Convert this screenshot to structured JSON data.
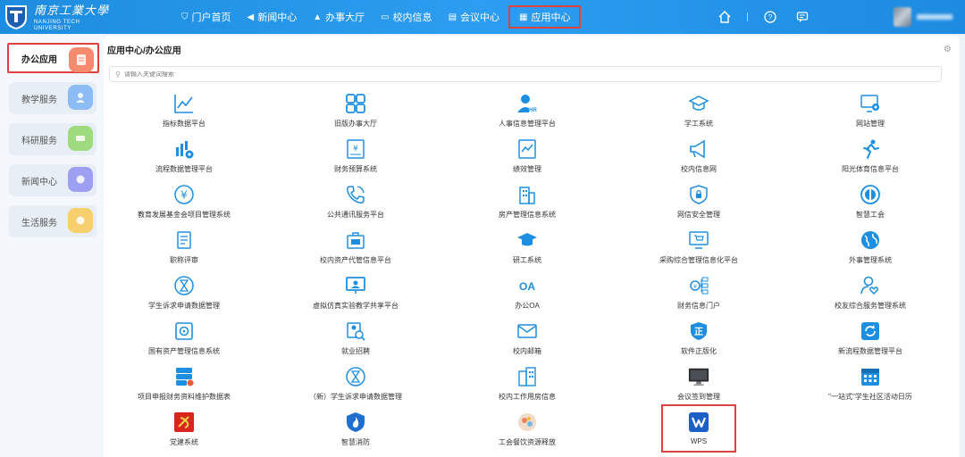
{
  "header": {
    "logo_cn": "南京工業大學",
    "logo_en_1": "NANJING TECH",
    "logo_en_2": "UNIVERSITY",
    "nav": [
      {
        "label": "门户首页",
        "icon": "shield-icon"
      },
      {
        "label": "新闻中心",
        "icon": "speaker-icon"
      },
      {
        "label": "办事大厅",
        "icon": "building-icon"
      },
      {
        "label": "校内信息",
        "icon": "monitor-icon"
      },
      {
        "label": "会议中心",
        "icon": "meeting-icon"
      },
      {
        "label": "应用中心",
        "icon": "grid-icon",
        "active": true
      }
    ],
    "right_icons": [
      "home-icon",
      "help-icon",
      "feedback-icon"
    ]
  },
  "sidebar": {
    "items": [
      {
        "label": "办公应用",
        "color": "#f27a5f",
        "active": true
      },
      {
        "label": "教学服务",
        "color": "#73aef0"
      },
      {
        "label": "科研服务",
        "color": "#8fd56c"
      },
      {
        "label": "新闻中心",
        "color": "#8c8ff0"
      },
      {
        "label": "生活服务",
        "color": "#f5c65a"
      }
    ]
  },
  "main": {
    "breadcrumb": "应用中心/办公应用",
    "search_placeholder": "请输入关键词搜索",
    "accent_color": "#1e90e0",
    "apps": [
      {
        "label": "指标数据平台",
        "icon": "chart-line-icon"
      },
      {
        "label": "旧版办事大厅",
        "icon": "grid-icon"
      },
      {
        "label": "人事信息管理平台",
        "icon": "hr-icon"
      },
      {
        "label": "学工系统",
        "icon": "graduation-icon"
      },
      {
        "label": "网站管理",
        "icon": "monitor-gear-icon"
      },
      {
        "label": "流程数据管理平台",
        "icon": "chart-gear-icon"
      },
      {
        "label": "财务预算系统",
        "icon": "yen-doc-icon"
      },
      {
        "label": "绩效管理",
        "icon": "chart-doc-icon"
      },
      {
        "label": "校内信息网",
        "icon": "megaphone-icon"
      },
      {
        "label": "阳光体育信息平台",
        "icon": "runner-icon"
      },
      {
        "label": "教育发展基金会项目管理系统",
        "icon": "yen-circle-icon"
      },
      {
        "label": "公共通讯服务平台",
        "icon": "phone-icon"
      },
      {
        "label": "房产管理信息系统",
        "icon": "building-icon"
      },
      {
        "label": "网信安全管理",
        "icon": "shield-lock-icon"
      },
      {
        "label": "智慧工会",
        "icon": "union-icon"
      },
      {
        "label": "职称评审",
        "icon": "doc-list-icon"
      },
      {
        "label": "校内资产代管信息平台",
        "icon": "briefcase-icon"
      },
      {
        "label": "研工系统",
        "icon": "graduation-cap-icon"
      },
      {
        "label": "采购综合管理信息化平台",
        "icon": "monitor-cart-icon"
      },
      {
        "label": "外事管理系统",
        "icon": "globe-icon"
      },
      {
        "label": "学生诉求申请数据管理",
        "icon": "hourglass-icon"
      },
      {
        "label": "虚拟仿真实验教学共享平台",
        "icon": "presentation-icon"
      },
      {
        "label": "办公OA",
        "icon": "oa-icon"
      },
      {
        "label": "财务信息门户",
        "icon": "money-network-icon"
      },
      {
        "label": "校友综合服务管理系统",
        "icon": "user-heart-icon"
      },
      {
        "label": "国有资产管理信息系统",
        "icon": "safe-icon"
      },
      {
        "label": "就业招聘",
        "icon": "job-search-icon"
      },
      {
        "label": "校内邮箱",
        "icon": "mail-icon"
      },
      {
        "label": "软件正版化",
        "icon": "zheng-badge-icon"
      },
      {
        "label": "新流程数据管理平台",
        "icon": "refresh-doc-icon"
      },
      {
        "label": "项目申报财务资料维护数据表",
        "icon": "db-edit-icon"
      },
      {
        "label": "（新）学生诉求申请数据管理",
        "icon": "hourglass-icon"
      },
      {
        "label": "校内工作用房信息",
        "icon": "office-building-icon"
      },
      {
        "label": "会议签到管理",
        "icon": "monitor-icon"
      },
      {
        "label": "\"一站式\"学生社区活动日历",
        "icon": "calendar-icon"
      },
      {
        "label": "党建系统",
        "icon": "party-icon"
      },
      {
        "label": "智慧消防",
        "icon": "fire-shield-icon"
      },
      {
        "label": "工会餐饮资源释放",
        "icon": "food-icon"
      },
      {
        "label": "WPS",
        "icon": "wps-icon",
        "highlight": true
      }
    ]
  }
}
